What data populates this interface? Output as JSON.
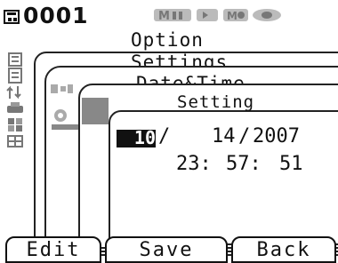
{
  "status": {
    "file_number": "0001"
  },
  "windows": {
    "option_title": "Option",
    "settings_title": "Settings",
    "datetime_title": "Date&Time",
    "setting_title": "Setting"
  },
  "datetime": {
    "month": "10",
    "sep1": "/",
    "day": "14",
    "sep2": "/",
    "year": "2007",
    "hour": "23",
    "minute": "57",
    "second": "51",
    "time_sep": ":"
  },
  "softkeys": {
    "edit": "Edit",
    "save": "Save",
    "back": "Back"
  },
  "colors": {
    "foreground": "#111111",
    "background": "#ffffff",
    "inactive": "#888888",
    "highlight": "#111111"
  },
  "icons": [
    "file-icon",
    "measure-mode-icon",
    "battery-icon",
    "list-icon",
    "settings-icon",
    "date-time-icon"
  ]
}
